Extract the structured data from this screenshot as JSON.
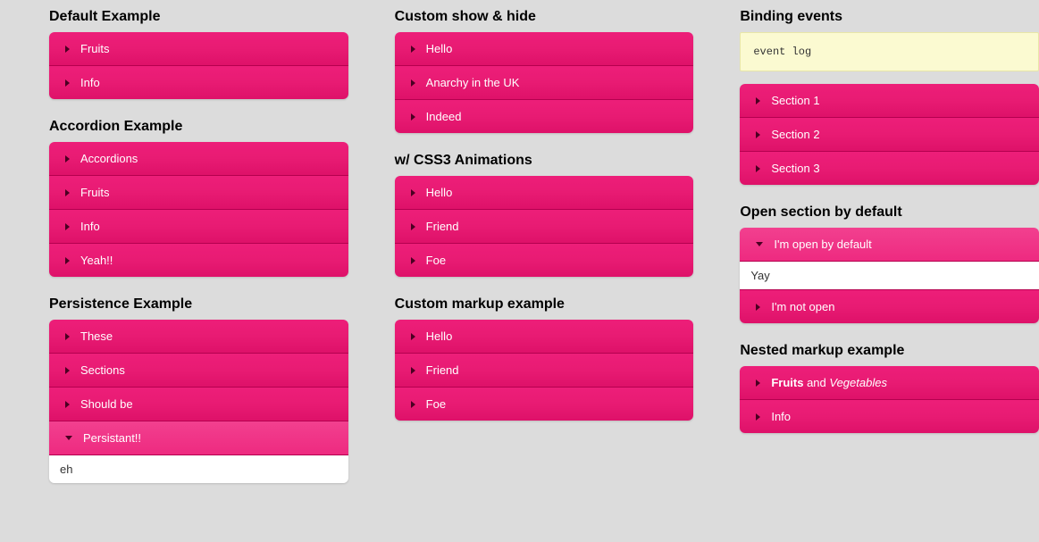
{
  "col1": {
    "default": {
      "title": "Default Example",
      "items": [
        {
          "label": "Fruits",
          "open": false
        },
        {
          "label": "Info",
          "open": false
        }
      ]
    },
    "accordion": {
      "title": "Accordion Example",
      "items": [
        {
          "label": "Accordions",
          "open": false
        },
        {
          "label": "Fruits",
          "open": false
        },
        {
          "label": "Info",
          "open": false
        },
        {
          "label": "Yeah!!",
          "open": false
        }
      ]
    },
    "persistence": {
      "title": "Persistence Example",
      "items": [
        {
          "label": "These",
          "open": false
        },
        {
          "label": "Sections",
          "open": false
        },
        {
          "label": "Should be",
          "open": false
        },
        {
          "label": "Persistant!!",
          "open": true,
          "content": "eh"
        }
      ]
    }
  },
  "col2": {
    "customshowhide": {
      "title": "Custom show & hide",
      "items": [
        {
          "label": "Hello",
          "open": false
        },
        {
          "label": "Anarchy in the UK",
          "open": false
        },
        {
          "label": "Indeed",
          "open": false
        }
      ]
    },
    "css3": {
      "title": "w/ CSS3 Animations",
      "items": [
        {
          "label": "Hello",
          "open": false
        },
        {
          "label": "Friend",
          "open": false
        },
        {
          "label": "Foe",
          "open": false
        }
      ]
    },
    "custommarkup": {
      "title": "Custom markup example",
      "items": [
        {
          "label": "Hello",
          "open": false
        },
        {
          "label": "Friend",
          "open": false
        },
        {
          "label": "Foe",
          "open": false
        }
      ]
    }
  },
  "col3": {
    "binding": {
      "title": "Binding events",
      "eventlog": "event log",
      "items": [
        {
          "label": "Section 1",
          "open": false
        },
        {
          "label": "Section 2",
          "open": false
        },
        {
          "label": "Section 3",
          "open": false
        }
      ]
    },
    "opendefault": {
      "title": "Open section by default",
      "items": [
        {
          "label": "I'm open by default",
          "open": true,
          "content": "Yay"
        },
        {
          "label": "I'm not open",
          "open": false
        }
      ]
    },
    "nested": {
      "title": "Nested markup example",
      "items": [
        {
          "label_html": "<b>Fruits</b> and <i>Vegetables</i>",
          "open": false
        },
        {
          "label": "Info",
          "open": false
        }
      ]
    }
  }
}
